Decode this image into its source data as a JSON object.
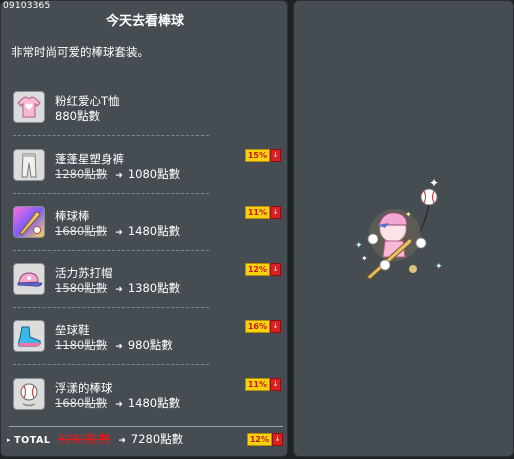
{
  "package": {
    "code": "09103365",
    "title": "今天去看棒球",
    "description": "非常时尚可爱的棒球套装。"
  },
  "items": [
    {
      "name": "粉红爱心T恤",
      "price": "880點數",
      "icon": "pink-heart-tshirt-icon"
    },
    {
      "name": "蓬蓬星塑身裤",
      "old_price": "1280點數",
      "new_price": "1080點數",
      "discount": "15%",
      "icon": "star-pants-icon"
    },
    {
      "name": "棒球棒",
      "old_price": "1680點數",
      "new_price": "1480點數",
      "discount": "11%",
      "icon": "baseball-bat-icon"
    },
    {
      "name": "活力苏打帽",
      "old_price": "1580點數",
      "new_price": "1380點數",
      "discount": "12%",
      "icon": "soda-cap-icon"
    },
    {
      "name": "垒球鞋",
      "old_price": "1180點數",
      "new_price": "980點數",
      "discount": "16%",
      "icon": "baseball-shoes-icon"
    },
    {
      "name": "浮漾的棒球",
      "old_price": "1680點數",
      "new_price": "1480點數",
      "discount": "11%",
      "icon": "floating-baseball-icon"
    }
  ],
  "total": {
    "label": "TOTAL",
    "old_price": "8280點數",
    "new_price": "7280點數",
    "discount": "12%"
  },
  "badge_down_glyph": "↓",
  "arrow_glyph": "➜",
  "colors": {
    "panel_bg": "#464d52",
    "badge_yellow": "#f7d211",
    "badge_red": "#d92121",
    "total_old_price": "#e01c1c"
  }
}
